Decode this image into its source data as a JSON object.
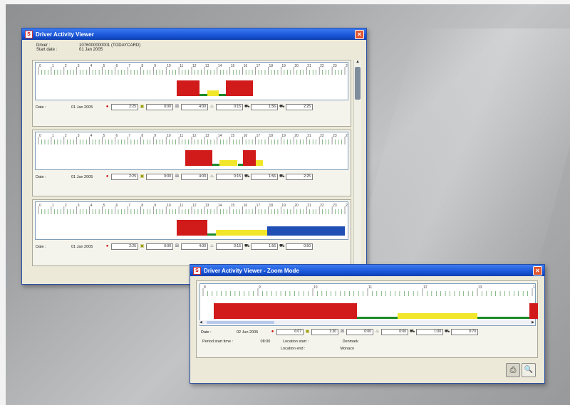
{
  "main_window": {
    "title": "Driver Activity Viewer",
    "driver_label": "Driver :",
    "driver_value": "1076000000001 (TODAYCARD)",
    "start_label": "Start date :",
    "start_value": "01 Jan 2005",
    "days": [
      {
        "date_label": "Date :",
        "date": "01 Jan 2005",
        "drive": "2:25",
        "work": "0:00",
        "poa": "4:00",
        "rest": "0:15",
        "break": "1:56",
        "total": "2:25",
        "segments": [
          {
            "type": "drive",
            "start": 10.8,
            "end": 12.6
          },
          {
            "type": "work",
            "start": 12.6,
            "end": 13.2
          },
          {
            "type": "poa",
            "start": 13.2,
            "end": 14.1
          },
          {
            "type": "work",
            "start": 14.1,
            "end": 14.7
          },
          {
            "type": "drive",
            "start": 14.7,
            "end": 16.8
          }
        ]
      },
      {
        "date_label": "Date :",
        "date": "01 Jan 2005",
        "drive": "2:25",
        "work": "0:00",
        "poa": "4:00",
        "rest": "0:15",
        "break": "1:56",
        "total": "2:25",
        "segments": [
          {
            "type": "drive",
            "start": 11.5,
            "end": 13.6
          },
          {
            "type": "work",
            "start": 13.6,
            "end": 14.2
          },
          {
            "type": "poa",
            "start": 14.2,
            "end": 15.6
          },
          {
            "type": "work",
            "start": 15.6,
            "end": 16.0
          },
          {
            "type": "drive",
            "start": 16.0,
            "end": 17.0
          },
          {
            "type": "poa",
            "start": 17.0,
            "end": 17.6
          }
        ]
      },
      {
        "date_label": "Date :",
        "date": "01 Jan 2005",
        "drive": "2:25",
        "work": "0:00",
        "poa": "4:00",
        "rest": "0:15",
        "break": "1:56",
        "total": "0:50",
        "segments": [
          {
            "type": "drive",
            "start": 10.8,
            "end": 13.2
          },
          {
            "type": "work",
            "start": 13.2,
            "end": 13.9
          },
          {
            "type": "poa",
            "start": 13.9,
            "end": 17.9
          },
          {
            "type": "rest",
            "start": 17.9,
            "end": 24
          }
        ]
      }
    ]
  },
  "zoom_window": {
    "title": "Driver Activity Viewer - Zoom Mode",
    "hours": [
      "8",
      "9",
      "10",
      "11",
      "12",
      "13",
      "14"
    ],
    "date_label": "Date :",
    "date": "02 Jun 2005",
    "drive": "6:07",
    "work": "1:30",
    "poa": "0:00",
    "rest": "0:00",
    "break": "1:00",
    "total": "0:70",
    "period_start_label": "Period start time :",
    "period_start": "08:00",
    "location_start_label": "Location start :",
    "location_start": "Denmark",
    "location_end_label": "Location end :",
    "location_end": "Monaco",
    "segments": [
      {
        "type": "drive",
        "start": 8.2,
        "end": 10.8
      },
      {
        "type": "work",
        "start": 10.8,
        "end": 11.55
      },
      {
        "type": "poa",
        "start": 11.55,
        "end": 13.0
      },
      {
        "type": "work",
        "start": 13.0,
        "end": 13.95
      },
      {
        "type": "drive",
        "start": 13.95,
        "end": 14.1
      }
    ],
    "print_icon": "printer-icon",
    "zoom_icon": "magnifier-icon"
  },
  "colors": {
    "drive": "#d11a1a",
    "work": "#1e8a2a",
    "poa": "#f2e62a",
    "rest": "#1f4fb4",
    "tick": "#3a8a3a"
  }
}
